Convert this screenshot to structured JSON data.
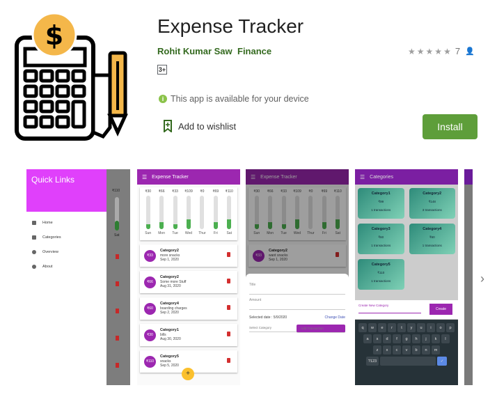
{
  "app": {
    "title": "Expense Tracker",
    "developer": "Rohit Kumar Saw",
    "category": "Finance",
    "rating_stars": 5,
    "rating_count": "7",
    "content_rating": "3+",
    "availability": "This app is available for your device",
    "wishlist_label": "Add to wishlist",
    "install_label": "Install",
    "accent": "#5e9e3a",
    "icon_name": "calculator-dollar-icon"
  },
  "screens": {
    "s1": {
      "drawer_title": "Quick Links",
      "menu": [
        "Home",
        "Categories",
        "Overview",
        "About"
      ],
      "peek_amount": "₹110",
      "peek_day": "Sat"
    },
    "common": {
      "header": "Expense Tracker",
      "days": [
        "Sun",
        "Mon",
        "Tue",
        "Wed",
        "Thur",
        "Fri",
        "Sat"
      ],
      "amounts": [
        "₹30",
        "₹66",
        "₹33",
        "₹109",
        "₹0",
        "₹69",
        "₹110"
      ],
      "fills": [
        0.15,
        0.2,
        0.15,
        0.3,
        0.0,
        0.2,
        0.3
      ]
    },
    "s2": {
      "transactions": [
        {
          "amount": "₹33",
          "category": "Category2",
          "note": "more snacks",
          "date": "Sep 1, 2020"
        },
        {
          "amount": "₹66",
          "category": "Category2",
          "note": "Some more Stuff",
          "date": "Aug 31, 2020"
        },
        {
          "amount": "₹60",
          "category": "Category4",
          "note": "boarding charges",
          "date": "Sep 2, 2020"
        },
        {
          "amount": "₹30",
          "category": "Category1",
          "note": "bills",
          "date": "Aug 30, 2020"
        },
        {
          "amount": "₹110",
          "category": "Category5",
          "note": "snacks",
          "date": "Sep 5, 2020"
        }
      ],
      "fab": "+"
    },
    "s3": {
      "tx": {
        "amount": "₹33",
        "category": "Category2",
        "note": "want snacks",
        "date": "Sep 1, 2020"
      },
      "title_ph": "Title",
      "amount_ph": "Amount",
      "selected_date": "Selected date : 5/9/2020",
      "change_date": "Change Date",
      "select_category": "Select Category",
      "add_tx": "Add Transaction"
    },
    "s4": {
      "header": "Categories",
      "tiles": [
        {
          "name": "Category1",
          "amount": "₹99",
          "count": "1 transactions"
        },
        {
          "name": "Category2",
          "amount": "₹148",
          "count": "3 transactions"
        },
        {
          "name": "Category3",
          "amount": "₹60",
          "count": "1 transactions"
        },
        {
          "name": "Category4",
          "amount": "₹60",
          "count": "1 transactions"
        },
        {
          "name": "Category5",
          "amount": "₹110",
          "count": "1 transactions"
        }
      ],
      "new_cat": "Create New Category",
      "create": "Create",
      "keys_row1": [
        "q",
        "w",
        "e",
        "r",
        "t",
        "y",
        "u",
        "i",
        "o",
        "p"
      ],
      "keys_row2": [
        "a",
        "s",
        "d",
        "f",
        "g",
        "h",
        "j",
        "k",
        "l"
      ],
      "keys_row3": [
        "z",
        "x",
        "c",
        "v",
        "b",
        "n",
        "m"
      ],
      "key_num": "?123"
    }
  }
}
